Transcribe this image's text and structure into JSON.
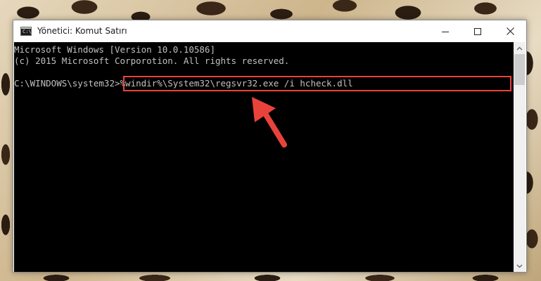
{
  "window": {
    "title": "Yönetici: Komut Satırı",
    "icon": "command-prompt-icon",
    "icon_glyph": "C:\\",
    "controls": {
      "minimize": "minimize-icon",
      "maximize": "maximize-icon",
      "close": "close-icon"
    }
  },
  "console": {
    "lines": [
      "Microsoft Windows [Version 10.0.10586]",
      "(c) 2015 Microsoft Corporotion. All rights reserved."
    ],
    "prompt": "C:\\WINDOWS\\system32>",
    "command": "%windir%\\System32\\regsvr32.exe /i hcheck.dll"
  },
  "annotation": {
    "highlight_color": "#e8433b",
    "arrow_icon": "red-arrow-icon"
  },
  "scrollbar": {
    "up_icon": "scroll-up-arrow-icon",
    "down_icon": "scroll-down-arrow-icon"
  }
}
